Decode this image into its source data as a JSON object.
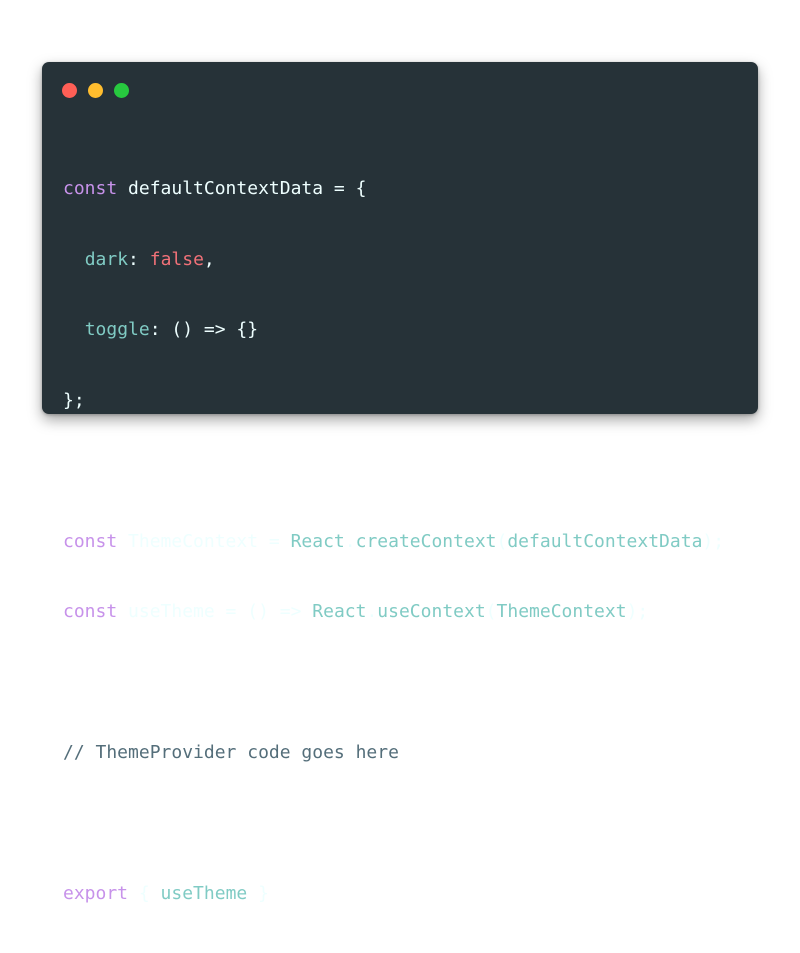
{
  "window": {
    "controls": [
      {
        "name": "close",
        "color": "#ff5f56"
      },
      {
        "name": "minimize",
        "color": "#ffbd2e"
      },
      {
        "name": "maximize",
        "color": "#27c93f"
      }
    ]
  },
  "code": {
    "line1": {
      "kw": "const",
      "rest": " defaultContextData = {"
    },
    "line2": {
      "indent": "  ",
      "key": "dark",
      "colon": ": ",
      "value": "false",
      "end": ","
    },
    "line3": {
      "indent": "  ",
      "key": "toggle",
      "rest": ": () => {}"
    },
    "line4": {
      "text": "};"
    },
    "line6": {
      "kw": "const",
      "name": " ThemeContext = ",
      "obj": "React",
      "dot": ".",
      "fn": "createContext",
      "open": "(",
      "arg": "defaultContextData",
      "close": ");"
    },
    "line7": {
      "kw": "const",
      "name": " useTheme = () => ",
      "obj": "React",
      "dot": ".",
      "fn": "useContext",
      "open": "(",
      "arg": "ThemeContext",
      "close": ");"
    },
    "line9": {
      "comment": "// ThemeProvider code goes here"
    },
    "line11": {
      "kw": "export",
      "open": " { ",
      "name": "useTheme",
      "close": " }"
    }
  }
}
